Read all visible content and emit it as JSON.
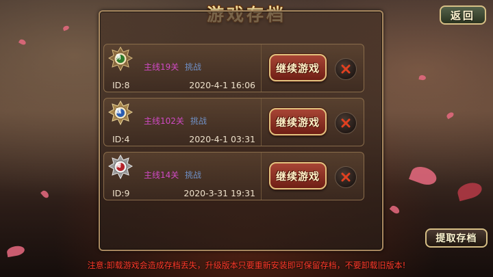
{
  "header": {
    "title": "游戏存档"
  },
  "back_button": {
    "label": "返回"
  },
  "extract_button": {
    "label": "提取存档"
  },
  "saves": [
    {
      "mission": "主线19关",
      "mode": "挑战",
      "id_text": "ID:8",
      "date": "2020-4-1 16:06",
      "badge": "勇",
      "badge_color": "#2d7a2a",
      "continue_label": "继续游戏"
    },
    {
      "mission": "主线102关",
      "mode": "挑战",
      "id_text": "ID:4",
      "date": "2020-4-1 03:31",
      "badge": "魏",
      "badge_color": "#2a5cb0",
      "continue_label": "继续游戏"
    },
    {
      "mission": "主线14关",
      "mode": "挑战",
      "id_text": "ID:9",
      "date": "2020-3-31 19:31",
      "badge": "蜀",
      "badge_color": "#b3222a",
      "continue_label": "继续游戏"
    }
  ],
  "notice": "注意:卸载游戏会造成存档丢失，升级版本只要重新安装即可保留存档，不要卸载旧版本!",
  "colors": {
    "mission": "#d04ac4",
    "mode": "#6f8fc4",
    "notice": "#ff3a2a",
    "delete_x": "#e04020"
  },
  "icons": {
    "delete": "close-icon",
    "avatar": "rank-badge-icon"
  }
}
